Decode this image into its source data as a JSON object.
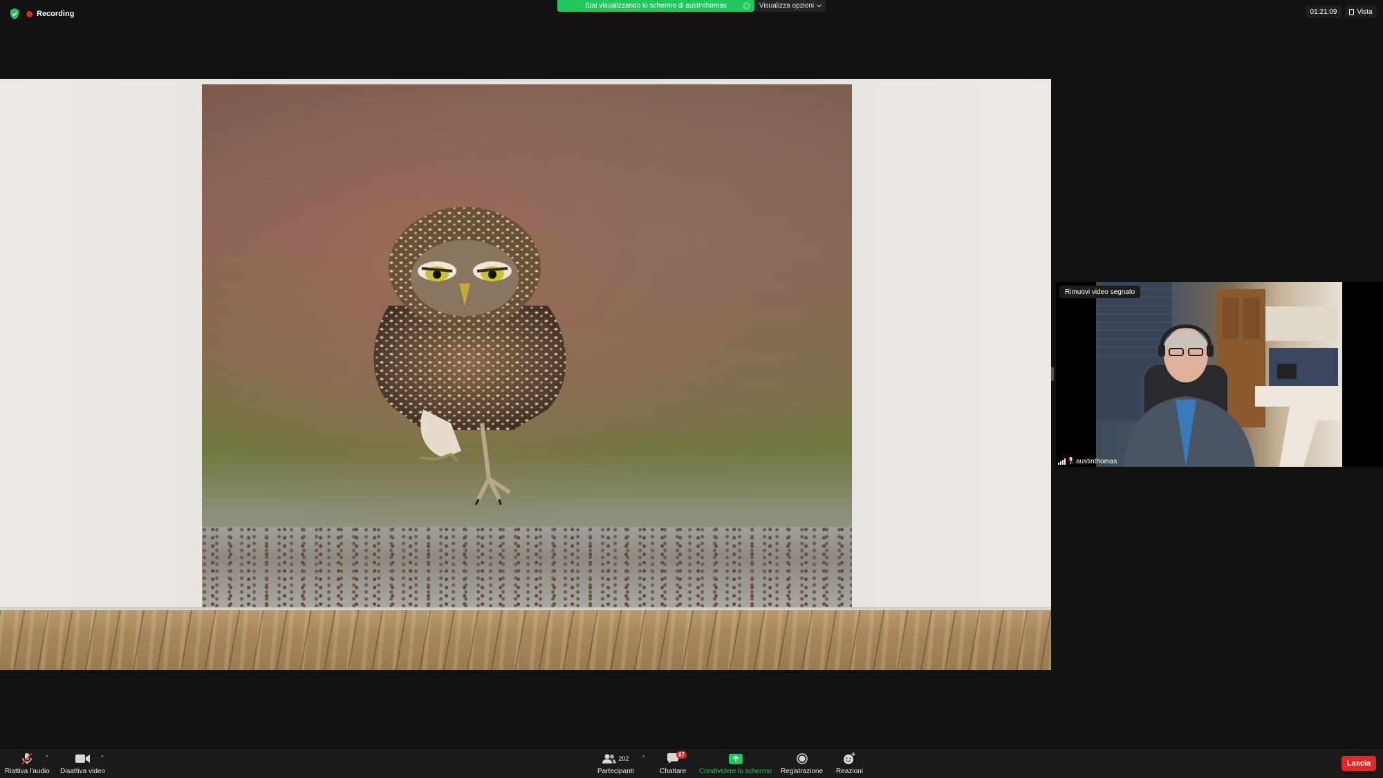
{
  "top": {
    "recording_label": "Recording",
    "share_banner": "Stai visualizzando lo schermo di austinthomas",
    "view_options": "Visualizza opzioni",
    "timer": "01:21:09",
    "view_label": "Vista"
  },
  "video": {
    "pinned_label": "Rimuovi video segnato",
    "participant_name": "austinthomas"
  },
  "toolbar": {
    "audio_label": "Riattiva l'audio",
    "video_label": "Disattiva video",
    "participants_label": "Partecipanti",
    "participants_count": "202",
    "chat_label": "Chattare",
    "chat_badge": "67",
    "share_label": "Condividere lo schermo",
    "record_label": "Registrazione",
    "reactions_label": "Reazioni",
    "leave_label": "Lascia"
  },
  "colors": {
    "share_green": "#22c55e",
    "leave_red": "#e02828",
    "background": "#121212"
  }
}
